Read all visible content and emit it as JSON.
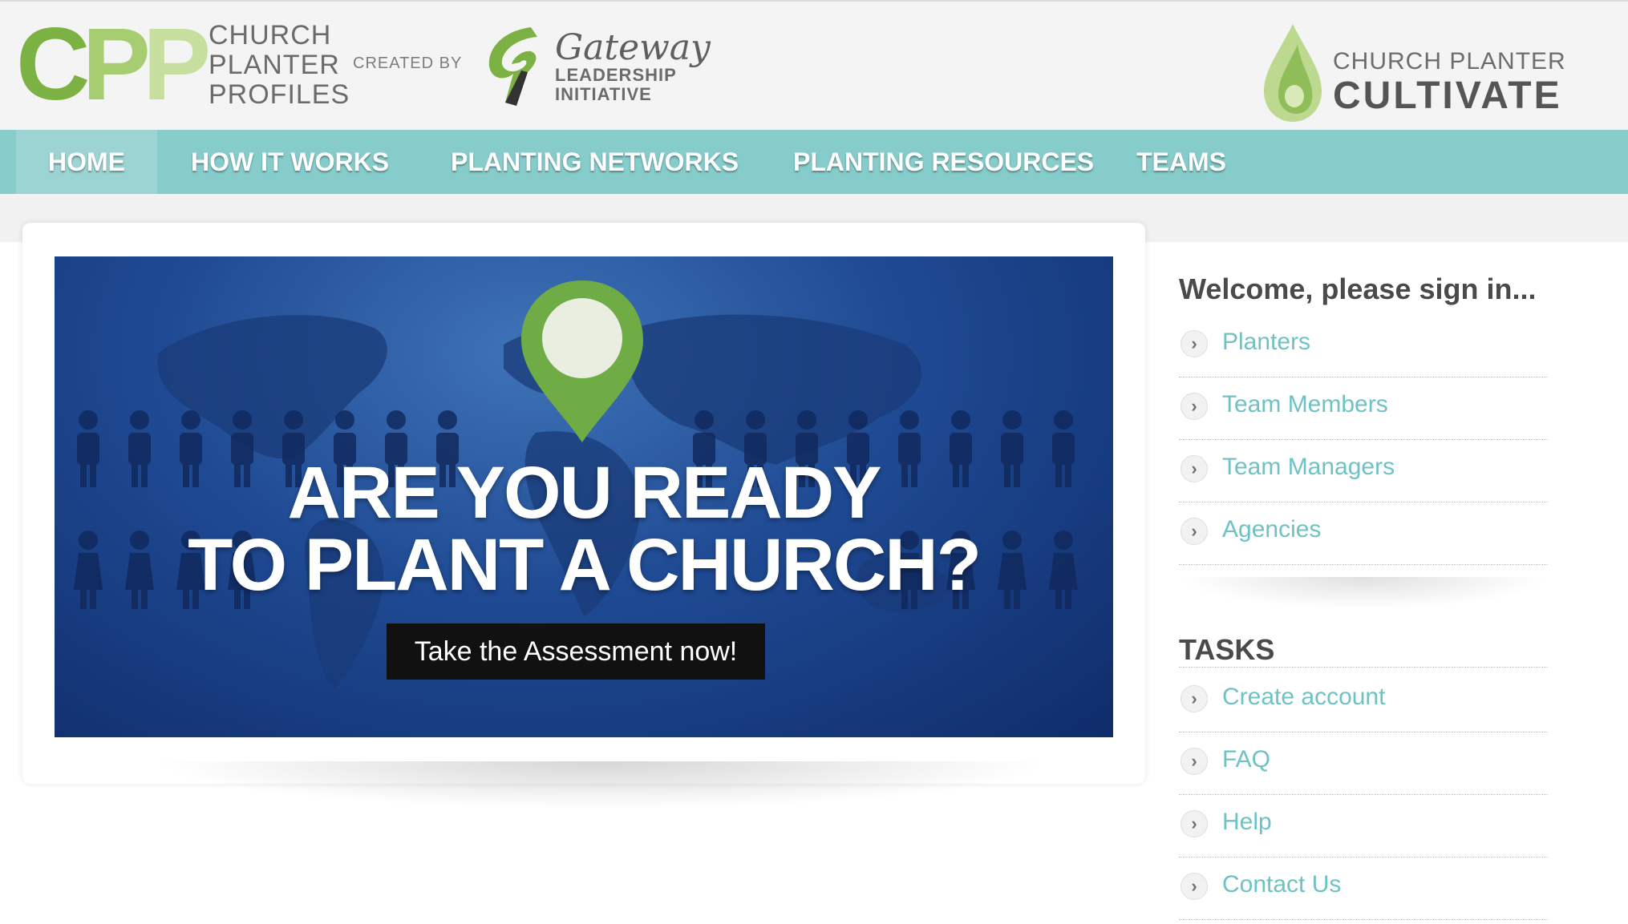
{
  "header": {
    "cpp_logo_letters": [
      "C",
      "P",
      "P"
    ],
    "cpp_logo_lines": [
      "CHURCH",
      "PLANTER",
      "PROFILES"
    ],
    "created_by": "CREATED BY",
    "gateway_script": "Gateway",
    "gateway_sub_lines": [
      "LEADERSHIP",
      "INITIATIVE"
    ],
    "cultivate_small": "CHURCH PLANTER",
    "cultivate_big": "CULTIVATE"
  },
  "nav": {
    "items": [
      {
        "label": "HOME",
        "active": true
      },
      {
        "label": "HOW IT WORKS",
        "active": false
      },
      {
        "label": "PLANTING NETWORKS",
        "active": false
      },
      {
        "label": "PLANTING RESOURCES",
        "active": false
      },
      {
        "label": "TEAMS",
        "active": false
      }
    ]
  },
  "banner": {
    "headline_lines": [
      "ARE YOU READY",
      "TO PLANT A CHURCH?"
    ],
    "cta_label": "Take the Assessment now!"
  },
  "sidebar": {
    "signin_title": "Welcome, please sign in...",
    "signin_items": [
      "Planters",
      "Team Members",
      "Team Managers",
      "Agencies"
    ],
    "tasks_title": "TASKS",
    "task_items": [
      "Create account",
      "FAQ",
      "Help",
      "Contact Us"
    ],
    "arrow_icon": "chevron-right-icon"
  },
  "colors": {
    "nav_bg": "#86cccb",
    "link": "#6fc2c3",
    "cpp_green": "#7bb243",
    "banner_blue": "#1f4a93"
  }
}
